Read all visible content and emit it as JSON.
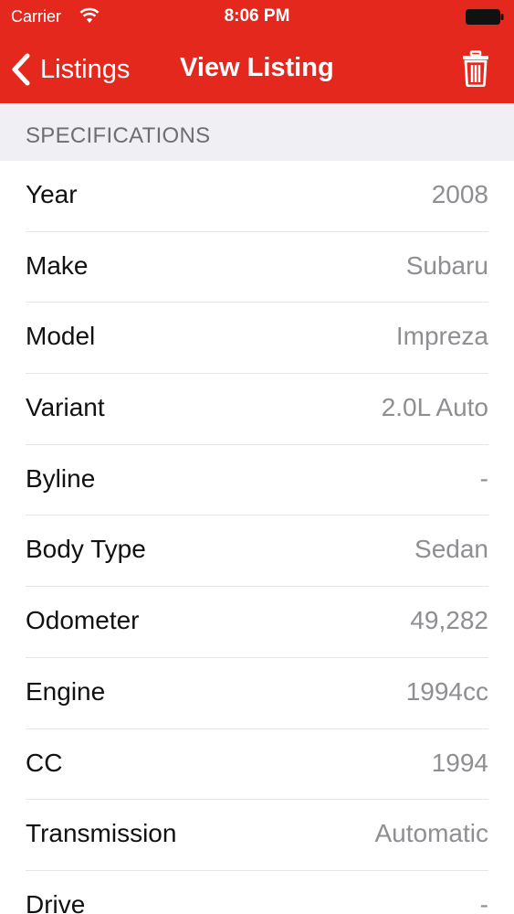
{
  "status_bar": {
    "carrier": "Carrier",
    "time": "8:06 PM"
  },
  "nav": {
    "back_label": "Listings",
    "title": "View Listing",
    "trash_icon": "trash-icon"
  },
  "section": {
    "title": "SPECIFICATIONS"
  },
  "specs": [
    {
      "label": "Year",
      "value": "2008"
    },
    {
      "label": "Make",
      "value": "Subaru"
    },
    {
      "label": "Model",
      "value": "Impreza"
    },
    {
      "label": "Variant",
      "value": "2.0L Auto"
    },
    {
      "label": "Byline",
      "value": "-"
    },
    {
      "label": "Body Type",
      "value": "Sedan"
    },
    {
      "label": "Odometer",
      "value": "49,282"
    },
    {
      "label": "Engine",
      "value": "1994cc"
    },
    {
      "label": "CC",
      "value": "1994"
    },
    {
      "label": "Transmission",
      "value": "Automatic"
    },
    {
      "label": "Drive",
      "value": "-"
    }
  ],
  "colors": {
    "accent": "#e5281e",
    "section_bg": "#efeff4",
    "value_text": "#8e8e93"
  }
}
